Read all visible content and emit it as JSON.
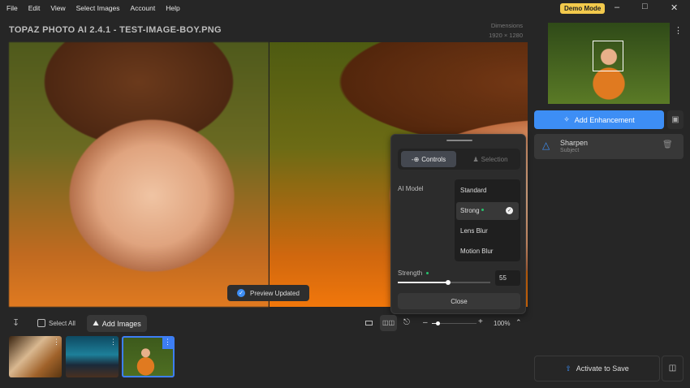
{
  "menu": [
    "File",
    "Edit",
    "View",
    "Select Images",
    "Account",
    "Help"
  ],
  "demo_mode": "Demo Mode",
  "title": "TOPAZ PHOTO AI 2.4.1 - TEST-IMAGE-BOY.PNG",
  "dimensions_label": "Dimensions",
  "dimensions_value": "1920 × 1280",
  "toast": "Preview Updated",
  "panel": {
    "tabs": [
      "Controls",
      "Selection"
    ],
    "ai_model_label": "AI Model",
    "models": [
      "Standard",
      "Strong",
      "Lens Blur",
      "Motion Blur"
    ],
    "selected_model": "Strong",
    "strength_label": "Strength",
    "strength_value": "55",
    "close": "Close"
  },
  "bottom": {
    "select_all": "Select All",
    "add_images": "Add Images",
    "zoom": "100%",
    "zoom_fraction": 0.15
  },
  "right": {
    "add_enhancement": "Add Enhancement",
    "enhancement": {
      "name": "Sharpen",
      "sub": "Subject"
    },
    "activate": "Activate to Save"
  },
  "colors": {
    "accent": "#3d8ef5",
    "demo": "#f2c94c",
    "dot": "#27c26c"
  }
}
